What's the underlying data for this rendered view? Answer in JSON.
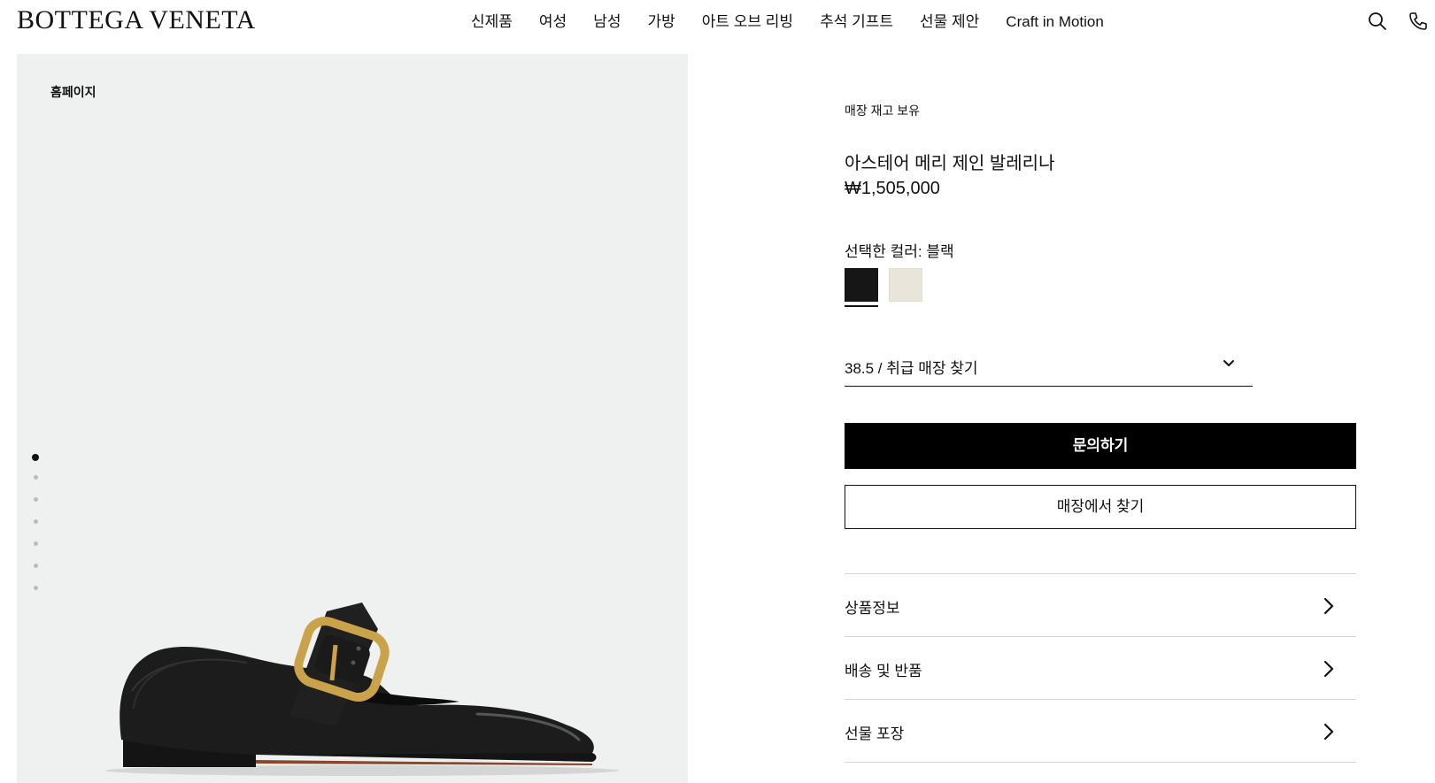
{
  "header": {
    "logo": "BOTTEGA VENETA",
    "nav": [
      "신제품",
      "여성",
      "남성",
      "가방",
      "아트 오브 리빙",
      "추석 기프트",
      "선물 제안",
      "Craft in Motion"
    ],
    "icons": [
      "search-icon",
      "phone-icon"
    ]
  },
  "gallery": {
    "breadcrumb": "홈페이지",
    "image_count": 7,
    "active_index": 0
  },
  "product": {
    "stock_status": "매장 재고 보유",
    "name": "아스테어 메리 제인 발레리나",
    "price": "₩1,505,000",
    "color_label": "선택한 컬러: 블랙",
    "colors": [
      {
        "name": "블랙",
        "hex": "#161616",
        "selected": true
      },
      {
        "name": "크림",
        "hex": "#e9e5da",
        "selected": false
      }
    ],
    "size_select": "38.5 / 취급 매장 찾기"
  },
  "actions": {
    "inquire": "문의하기",
    "find_store": "매장에서 찾기"
  },
  "accordion": [
    "상품정보",
    "배송 및 반품",
    "선물 포장"
  ]
}
